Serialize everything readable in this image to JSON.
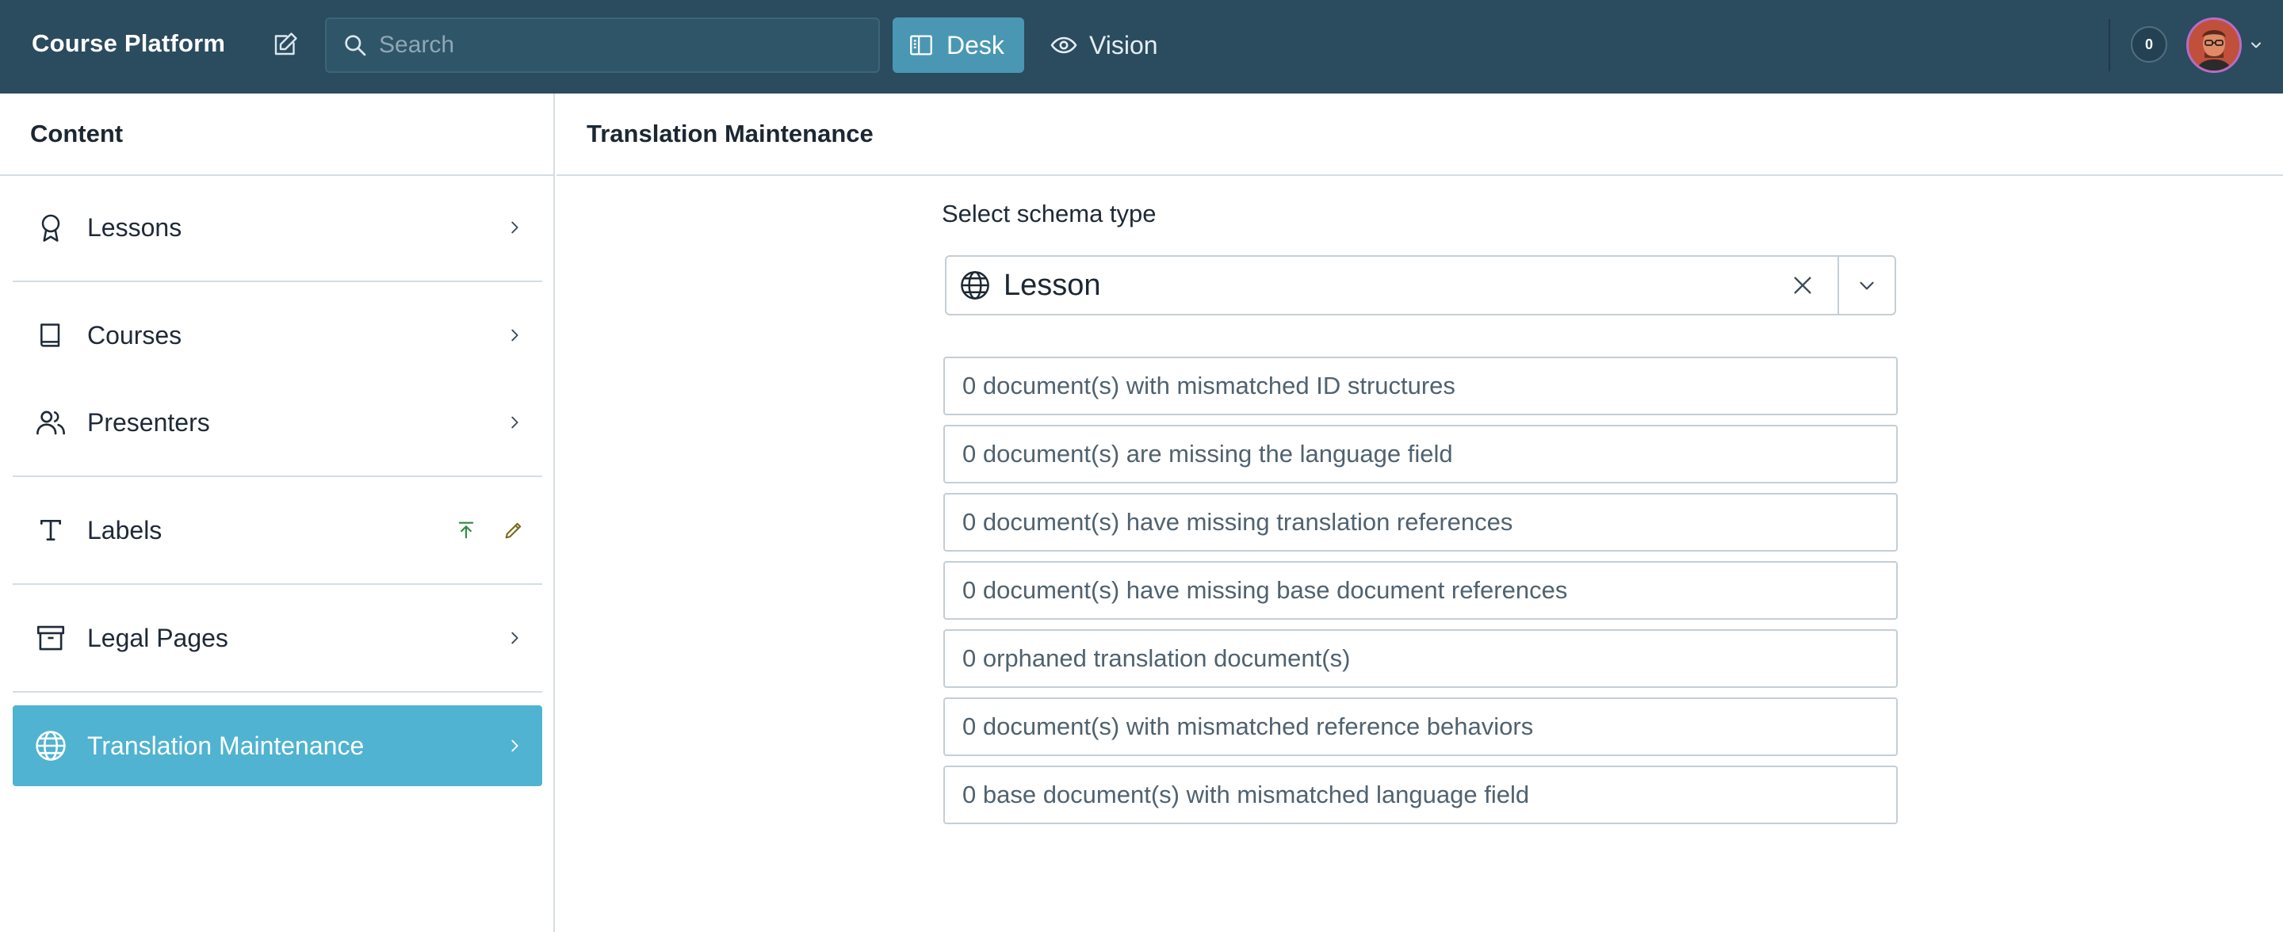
{
  "app": {
    "title": "Course Platform"
  },
  "topbar": {
    "search_placeholder": "Search",
    "tools": [
      {
        "label": "Desk",
        "icon": "desk-icon",
        "active": true
      },
      {
        "label": "Vision",
        "icon": "eye-icon",
        "active": false
      }
    ],
    "notification_count": "0"
  },
  "sidebar": {
    "title": "Content",
    "items": [
      {
        "label": "Lessons",
        "icon": "award-icon"
      },
      {
        "label": "Courses",
        "icon": "book-icon"
      },
      {
        "label": "Presenters",
        "icon": "users-icon"
      },
      {
        "label": "Labels",
        "icon": "text-icon"
      },
      {
        "label": "Legal Pages",
        "icon": "archive-icon"
      },
      {
        "label": "Translation Maintenance",
        "icon": "globe-icon",
        "active": true
      }
    ]
  },
  "main": {
    "title": "Translation Maintenance",
    "schema_label": "Select schema type",
    "schema_value": "Lesson",
    "results": [
      "0 document(s) with mismatched ID structures",
      "0 document(s) are missing the language field",
      "0 document(s) have missing translation references",
      "0 document(s) have missing base document references",
      "0 orphaned translation document(s)",
      "0 document(s) with mismatched reference behaviors",
      "0 base document(s) with mismatched language field"
    ]
  },
  "colors": {
    "topbar_bg": "#2b4b5e",
    "desk_active_bg": "#4a97b3",
    "sidebar_active_bg": "#4fb3d1",
    "labels_action_green": "#2f8a3e"
  }
}
